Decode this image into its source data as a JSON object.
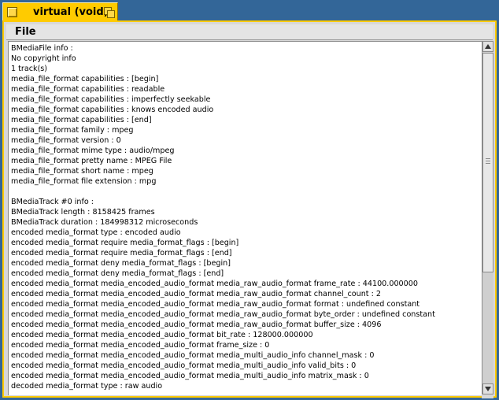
{
  "window": {
    "title": "virtual (void)"
  },
  "menubar": {
    "items": [
      "File"
    ]
  },
  "content": {
    "lines": [
      "BMediaFile info :",
      "No copyright info",
      "1 track(s)",
      "media_file_format capabilities : [begin]",
      "media_file_format capabilities : readable",
      "media_file_format capabilities : imperfectly seekable",
      "media_file_format capabilities : knows encoded audio",
      "media_file_format capabilities : [end]",
      "media_file_format family : mpeg",
      "media_file_format version : 0",
      "media_file_format mime type : audio/mpeg",
      "media_file_format pretty name : MPEG File",
      "media_file_format short name : mpeg",
      "media_file_format file extension : mpg",
      "",
      "BMediaTrack #0 info :",
      "BMediaTrack length : 8158425 frames",
      "BMediaTrack duration : 184998312 microseconds",
      "encoded media_format type : encoded audio",
      "encoded media_format require media_format_flags : [begin]",
      "encoded media_format require media_format_flags : [end]",
      "encoded media_format deny media_format_flags : [begin]",
      "encoded media_format deny media_format_flags : [end]",
      "encoded media_format media_encoded_audio_format media_raw_audio_format frame_rate : 44100.000000",
      "encoded media_format media_encoded_audio_format media_raw_audio_format channel_count : 2",
      "encoded media_format media_encoded_audio_format media_raw_audio_format format : undefined constant",
      "encoded media_format media_encoded_audio_format media_raw_audio_format byte_order : undefined constant",
      "encoded media_format media_encoded_audio_format media_raw_audio_format buffer_size : 4096",
      "encoded media_format media_encoded_audio_format bit_rate : 128000.000000",
      "encoded media_format media_encoded_audio_format frame_size : 0",
      "encoded media_format media_encoded_audio_format media_multi_audio_info channel_mask : 0",
      "encoded media_format media_encoded_audio_format media_multi_audio_info valid_bits : 0",
      "encoded media_format media_encoded_audio_format media_multi_audio_info matrix_mask : 0",
      "decoded media_format type : raw audio"
    ]
  },
  "colors": {
    "desktop": "#336698",
    "tab": "#ffcb00",
    "window_frame": "#d8d8d8",
    "content_bg": "#ffffff"
  }
}
